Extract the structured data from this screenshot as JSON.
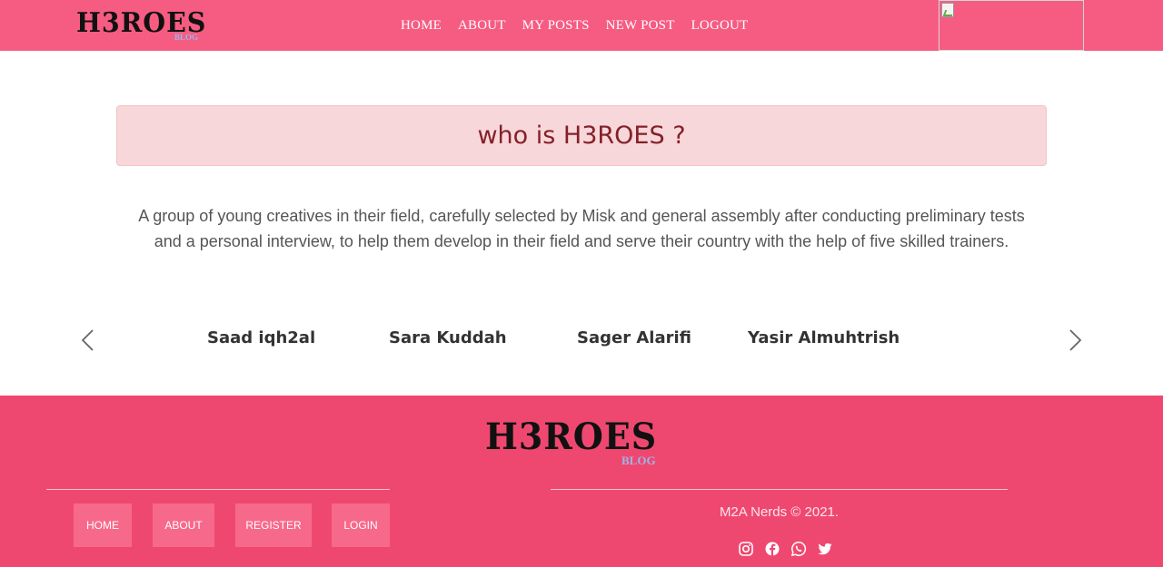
{
  "brand": {
    "main": "H3ROES",
    "sub": "BLOG"
  },
  "nav": {
    "links": [
      "HOME",
      "ABOUT",
      "MY POSTS",
      "NEW POST",
      "LOGOUT"
    ]
  },
  "hero": {
    "title": "who is H3ROES ?"
  },
  "description": "A group of young creatives in their field, carefully selected by Misk and general assembly after conducting preliminary tests and a personal interview, to help them develop in their field and serve their country with the help of five skilled trainers.",
  "carousel": {
    "members": [
      "Saad iqh2al",
      "Sara Kuddah",
      "Sager Alarifi",
      "Yasir Almuhtrish"
    ],
    "prev_icon": "chevron-left-icon",
    "next_icon": "chevron-right-icon"
  },
  "footer": {
    "brand_main": "H3ROES",
    "brand_sub": "BLOG",
    "buttons": [
      "HOME",
      "ABOUT",
      "REGISTER",
      "LOGIN"
    ],
    "copyright": "M2A Nerds © 2021.",
    "socials": [
      "instagram-icon",
      "facebook-icon",
      "whatsapp-icon",
      "twitter-icon"
    ]
  },
  "colors": {
    "navbar": "#f65c82",
    "footer": "#ef4870",
    "hero_bg": "#f8d7da",
    "hero_text": "#842029",
    "footer_button": "#f7698b"
  }
}
